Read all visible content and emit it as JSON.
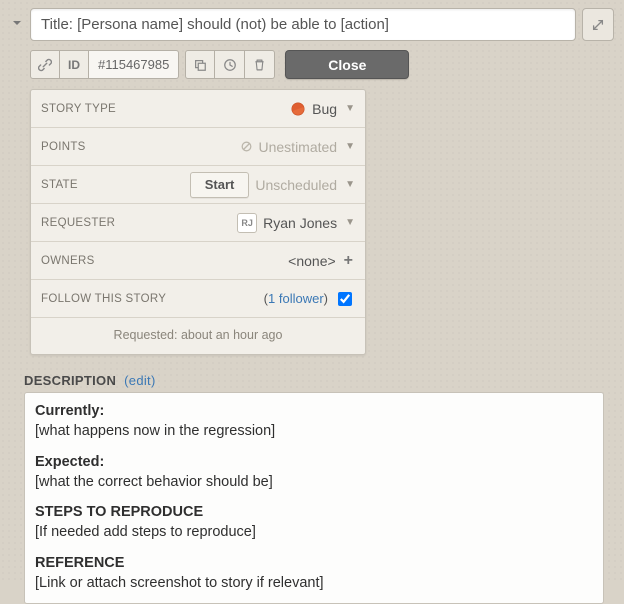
{
  "title": {
    "value": "Title: [Persona name] should (not) be able to [action]"
  },
  "story": {
    "id": "#115467985",
    "id_label": "ID",
    "close_label": "Close",
    "requested_ago": "Requested: about an hour ago"
  },
  "fields": {
    "story_type": {
      "label": "STORY TYPE",
      "value": "Bug"
    },
    "points": {
      "label": "POINTS",
      "value": "Unestimated"
    },
    "state": {
      "label": "STATE",
      "button": "Start",
      "value": "Unscheduled"
    },
    "requester": {
      "label": "REQUESTER",
      "initials": "RJ",
      "name": "Ryan Jones"
    },
    "owners": {
      "label": "OWNERS",
      "value": "<none>"
    },
    "follow": {
      "label": "FOLLOW THIS STORY",
      "count_prefix": "(",
      "count_link": "1 follower",
      "count_suffix": ")"
    }
  },
  "description": {
    "header": "DESCRIPTION",
    "edit": "(edit)",
    "blocks": {
      "currently_h": "Currently:",
      "currently_t": "[what happens now in the regression]",
      "expected_h": "Expected:",
      "expected_t": "[what the correct behavior should be]",
      "steps_h": "STEPS TO REPRODUCE",
      "steps_t": "[If needed add steps to reproduce]",
      "reference_h": "REFERENCE",
      "reference_t": "[Link or attach screenshot to story if relevant]"
    }
  }
}
